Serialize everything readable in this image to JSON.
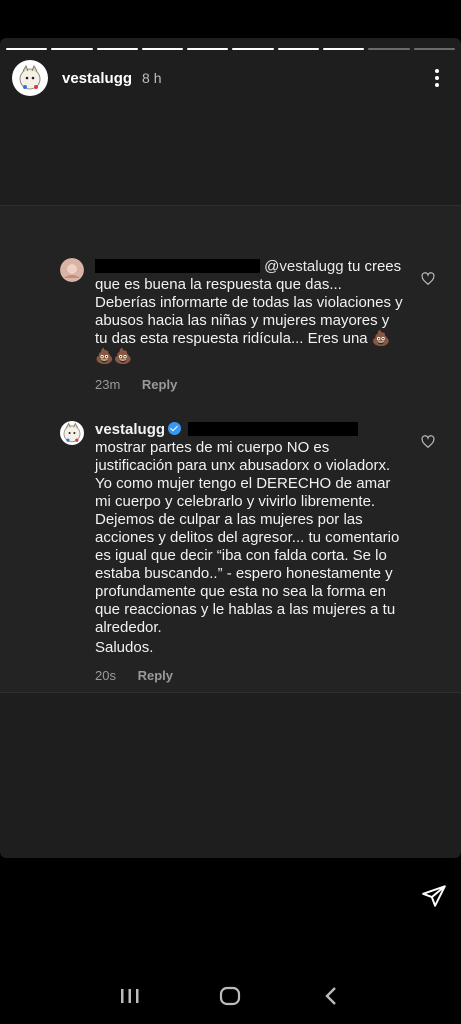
{
  "story": {
    "progress_segments": 10,
    "active_segment": 7,
    "username": "vestalugg",
    "time": "8 h"
  },
  "comments": [
    {
      "mention": "@vestalugg",
      "text_after_mention": " tu crees que es buena la respuesta que das... Deberías informarte de todas las violaciones y abusos hacia las niñas y mujeres mayores y tu das esta respuesta ridícula... Eres una 💩💩💩",
      "time": "23m",
      "reply_label": "Reply"
    },
    {
      "username": "vestalugg",
      "text": "mostrar partes de mi cuerpo NO es justificación para unx abusadorx o violadorx. Yo como mujer tengo el DERECHO de amar mi cuerpo y celebrarlo y vivirlo libremente. Dejemos de culpar a las mujeres por las acciones y delitos del agresor... tu comentario es igual que decir “iba con falda corta. Se lo estaba buscando..” - espero honestamente y profundamente que esta no sea la forma en que reaccionas y le hablas a las mujeres a tu alrededor.",
      "signoff": "Saludos.",
      "time": "20s",
      "reply_label": "Reply"
    }
  ],
  "icons": {
    "more": "more-vertical-icon",
    "like": "heart-outline-icon",
    "send": "paper-plane-icon",
    "nav_recents": "recents-icon",
    "nav_home": "home-icon",
    "nav_back": "back-icon",
    "verified": "verified-badge-icon"
  },
  "colors": {
    "background": "#000000",
    "card": "#1e1e1e",
    "comment_card": "#232323",
    "verified": "#3897f0"
  }
}
